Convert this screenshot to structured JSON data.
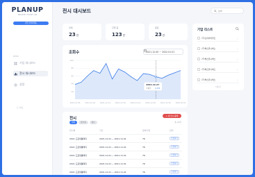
{
  "brand": {
    "logo": "PLANUP",
    "tagline": "PRIVATE / TICKET / JB",
    "button": "기업 관리자메뉴"
  },
  "nav": {
    "section": "MENU",
    "items": [
      {
        "label": "기업 대시보드",
        "active": false
      },
      {
        "label": "전시 대시보드",
        "active": true
      },
      {
        "label": "설정",
        "active": false
      }
    ],
    "footer": "로그아웃"
  },
  "header": {
    "title": "전시 대시보드",
    "search_placeholder": "검색"
  },
  "stats": [
    {
      "label": "전체",
      "value": "23",
      "unit": "건"
    },
    {
      "label": "진행 중",
      "value": "123",
      "unit": "건"
    },
    {
      "label": "종료",
      "value": "23",
      "unit": "건"
    }
  ],
  "views": {
    "title": "조회수",
    "date_range": "2021.12.00 ~ 2022.01.01",
    "tooltip": {
      "date": "2021.12.27",
      "label": "조회수",
      "value": "1,234"
    }
  },
  "chart_data": {
    "type": "area",
    "x": [
      "2021.12.06",
      "2021.12.08",
      "2021.12.10",
      "2021.12.12",
      "2021.12.14",
      "2021.12.16",
      "2021.12.18",
      "2021.12.20",
      "2021.12.22",
      "2021.12.24",
      "2021.12.26",
      "2021.12.28",
      "2021.12.30",
      "2022.01.01"
    ],
    "points": [
      {
        "x": 0,
        "y": 38
      },
      {
        "x": 1,
        "y": 44
      },
      {
        "x": 2,
        "y": 60
      },
      {
        "x": 3,
        "y": 74
      },
      {
        "x": 4,
        "y": 67
      },
      {
        "x": 5,
        "y": 92
      },
      {
        "x": 6,
        "y": 52
      },
      {
        "x": 7,
        "y": 78
      },
      {
        "x": 8,
        "y": 70
      },
      {
        "x": 9,
        "y": 58
      },
      {
        "x": 10,
        "y": 48
      },
      {
        "x": 11,
        "y": 66
      },
      {
        "x": 12,
        "y": 64
      },
      {
        "x": 13,
        "y": 58
      },
      {
        "x": 14,
        "y": 54
      },
      {
        "x": 15,
        "y": 62
      },
      {
        "x": 16,
        "y": 68
      },
      {
        "x": 17,
        "y": 74
      }
    ],
    "ylim": [
      0,
      100
    ],
    "yticks": [
      "100",
      "80",
      "60",
      "40",
      "20"
    ],
    "xticks": [
      "2021.12.06",
      "2021.12.10",
      "2021.12.14",
      "2021.12.18",
      "2021.12.22",
      "2021.12.26",
      "2021.12.30",
      "2022.01.01"
    ],
    "highlight_index": 13,
    "color": "#4a86e8"
  },
  "exhibitions": {
    "title": "전시",
    "add_button": "+ 새 전시 등록",
    "filters": [
      "전체",
      "진행 중",
      "종료"
    ],
    "count": "총 23건",
    "columns": [
      "전시명",
      "기간",
      "참여기업",
      "관리"
    ],
    "rows": [
      {
        "name": "2021 드로잉톰테디",
        "period": "2021.11.01 ~ 2021.11.01",
        "companies": "76",
        "action": "수정하기"
      },
      {
        "name": "2021 드로잉톰테디",
        "period": "2021.11.01 ~ 2021.11.01",
        "companies": "76",
        "action": "수정하기"
      },
      {
        "name": "2021 드로잉톰테디",
        "period": "2021.11.01 ~ 2021.11.01",
        "companies": "76",
        "action": "수정하기"
      },
      {
        "name": "2021 드로잉톰테디",
        "period": "2021.11.01 ~ 2021.11.01",
        "companies": "76",
        "action": "수정하기"
      },
      {
        "name": "2021 드로잉톰테디",
        "period": "2021.11.01 ~ 2021.11.01",
        "companies": "76",
        "action": "수정하기"
      }
    ]
  },
  "companies": {
    "title": "기업 리스트",
    "items": [
      "(주)프리카이언트",
      "(주)엑스유니버스",
      "(주)엑스유니버스",
      "(주)엑스유니버스",
      "(주)엑스유니버스"
    ],
    "more": "더보기"
  }
}
